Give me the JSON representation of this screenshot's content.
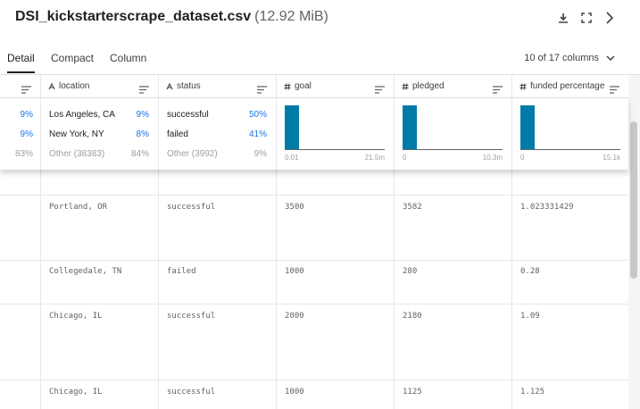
{
  "header": {
    "title": "DSI_kickstarterscrape_dataset.csv",
    "size": "(12.92 MiB)",
    "icons": [
      "download-icon",
      "expand-icon",
      "chevron-right-icon"
    ]
  },
  "tabs": [
    {
      "label": "Detail",
      "active": true
    },
    {
      "label": "Compact",
      "active": false
    },
    {
      "label": "Column",
      "active": false
    }
  ],
  "column_count": "10 of 17 columns",
  "columns": {
    "location": {
      "name": "location",
      "type_icon": "text-type-icon"
    },
    "status": {
      "name": "status",
      "type_icon": "text-type-icon"
    },
    "goal": {
      "name": "goal",
      "type_icon": "number-type-icon"
    },
    "pledged": {
      "name": "pledged",
      "type_icon": "number-type-icon"
    },
    "funded": {
      "name": "funded percentage",
      "type_icon": "number-type-icon"
    }
  },
  "summary": {
    "prev_col": [
      "9%",
      "9%",
      "83%"
    ],
    "location": [
      {
        "label": "Los Angeles, CA",
        "pct": "9%"
      },
      {
        "label": "New York, NY",
        "pct": "8%"
      },
      {
        "label": "Other (38383)",
        "pct": "84%"
      }
    ],
    "status": [
      {
        "label": "successful",
        "pct": "50%"
      },
      {
        "label": "failed",
        "pct": "41%"
      },
      {
        "label": "Other (3992)",
        "pct": "9%"
      }
    ],
    "goal_hist": {
      "min": "0.01",
      "max": "21.5m"
    },
    "pledged_hist": {
      "min": "0",
      "max": "10.3m"
    },
    "funded_hist": {
      "min": "0",
      "max": "15.1k"
    }
  },
  "rows": [
    {
      "location": "Portland, OR",
      "status": "successful",
      "goal": "3500",
      "pledged": "3582",
      "funded": "1.023331429"
    },
    {
      "location": "Collegedale, TN",
      "status": "failed",
      "goal": "1000",
      "pledged": "280",
      "funded": "0.28"
    },
    {
      "location": "Chicago, IL",
      "status": "successful",
      "goal": "2000",
      "pledged": "2180",
      "funded": "1.09"
    },
    {
      "location": "Chicago, IL",
      "status": "successful",
      "goal": "1000",
      "pledged": "1125",
      "funded": "1.125"
    }
  ],
  "colors": {
    "accent": "#1a73e8",
    "histogram": "#007ba8"
  }
}
